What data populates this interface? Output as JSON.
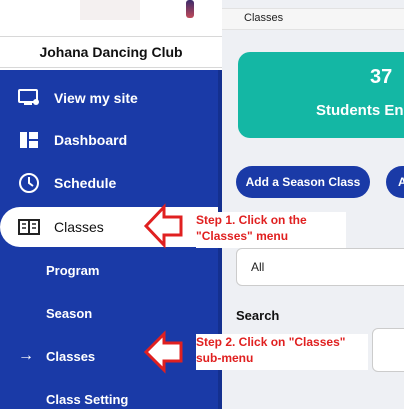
{
  "sidebar": {
    "club_name": "Johana Dancing Club",
    "items": [
      {
        "label": "View my site",
        "icon": "monitor-user-icon"
      },
      {
        "label": "Dashboard",
        "icon": "dashboard-icon"
      },
      {
        "label": "Schedule",
        "icon": "clock-icon"
      },
      {
        "label": "Classes",
        "icon": "book-icon",
        "active": true
      }
    ],
    "sub_items": [
      {
        "label": "Program"
      },
      {
        "label": "Season"
      },
      {
        "label": "Classes",
        "prefix": "→"
      },
      {
        "label": "Class Setting"
      }
    ]
  },
  "topbar": {
    "breadcrumb": "Classes"
  },
  "stat_card": {
    "value": "37",
    "label": "Students Enro"
  },
  "actions": {
    "add_season_class": "Add a Season Class",
    "second_button": "A"
  },
  "filter": {
    "select_value": "All"
  },
  "search": {
    "label": "Search"
  },
  "annotations": {
    "step1_line1": "Step 1. Click on the",
    "step1_line2": "\"Classes\" menu",
    "step2_line1": "Step 2. Click on \"Classes\"",
    "step2_line2": "sub-menu"
  },
  "colors": {
    "sidebar_bg": "#1a3aa7",
    "accent_teal": "#14b7a4",
    "annotation_red": "#e02020"
  }
}
